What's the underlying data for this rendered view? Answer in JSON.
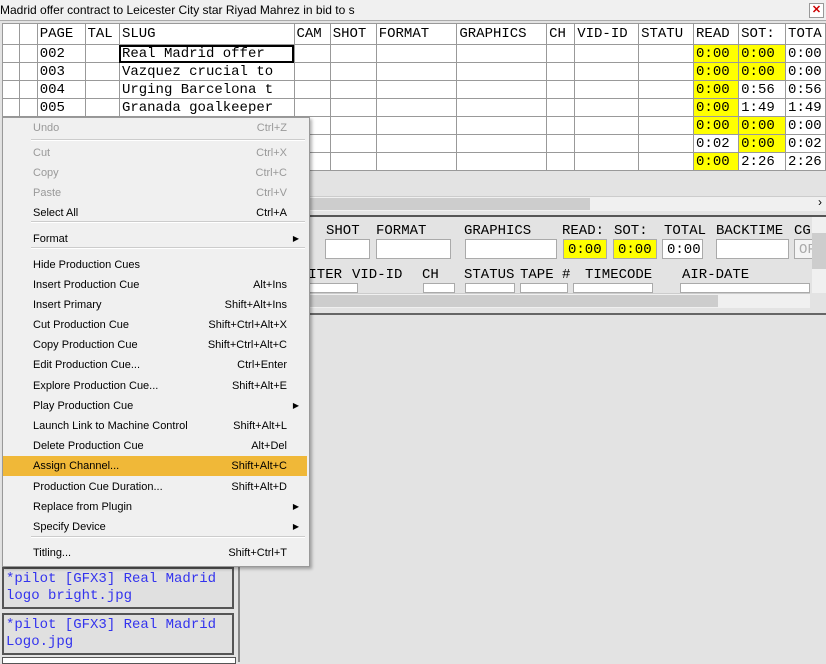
{
  "window": {
    "title": "Madrid offer contract to Leicester City star Riyad Mahrez in bid to s",
    "close_icon": "close-icon"
  },
  "grid": {
    "columns": [
      "",
      "",
      "PAGE",
      "TAL",
      "SLUG",
      "CAM",
      "SHOT",
      "FORMAT",
      "GRAPHICS",
      "CH",
      "VID-ID",
      "STATU",
      "READ",
      "SOT:",
      "TOTA"
    ],
    "rows": [
      {
        "page": "002",
        "slug": "Real Madrid offer",
        "read": "0:00",
        "sot": "0:00",
        "total": "0:00",
        "read_hl": true,
        "sot_hl": true
      },
      {
        "page": "003",
        "slug": "Vazquez crucial to",
        "read": "0:00",
        "sot": "0:00",
        "total": "0:00",
        "read_hl": true,
        "sot_hl": true
      },
      {
        "page": "004",
        "slug": "Urging Barcelona t",
        "read": "0:00",
        "sot": "0:56",
        "total": "0:56",
        "read_hl": true,
        "sot_hl": false
      },
      {
        "page": "005",
        "slug": "Granada goalkeeper",
        "read": "0:00",
        "sot": "1:49",
        "total": "1:49",
        "read_hl": true,
        "sot_hl": false
      },
      {
        "page": "",
        "slug": "",
        "read": "0:00",
        "sot": "0:00",
        "total": "0:00",
        "read_hl": true,
        "sot_hl": true
      },
      {
        "page": "",
        "slug": "",
        "read": "0:02",
        "sot": "0:00",
        "total": "0:02",
        "read_hl": false,
        "sot_hl": true
      },
      {
        "page": "",
        "slug": "",
        "read": "0:00",
        "sot": "2:26",
        "total": "2:26",
        "read_hl": true,
        "sot_hl": false
      }
    ],
    "highlight_color": "#ffff00"
  },
  "form": {
    "row1_labels": [
      "I",
      "SHOT",
      "FORMAT",
      "GRAPHICS",
      "READ:",
      "SOT:",
      "TOTAL",
      "BACKTIME",
      "CG"
    ],
    "read": "0:00",
    "sot": "0:00",
    "total": "0:00",
    "cg": "OF",
    "row2_labels": [
      "RITER",
      "VID-ID",
      "CH",
      "STATUS",
      "TAPE #",
      "TIMECODE",
      "AIR-DATE"
    ]
  },
  "menu": {
    "highlight_color": "#f0b838",
    "items": [
      {
        "label": "Undo",
        "shortcut": "Ctrl+Z",
        "disabled": true
      },
      {
        "label": "Cut",
        "shortcut": "Ctrl+X",
        "disabled": true
      },
      {
        "label": "Copy",
        "shortcut": "Ctrl+C",
        "disabled": true
      },
      {
        "label": "Paste",
        "shortcut": "Ctrl+V",
        "disabled": true
      },
      {
        "label": "Select All",
        "shortcut": "Ctrl+A"
      },
      {
        "label": "Format",
        "shortcut": "",
        "submenu": true
      },
      {
        "label": "Hide Production Cues",
        "shortcut": ""
      },
      {
        "label": "Insert Production Cue",
        "shortcut": "Alt+Ins"
      },
      {
        "label": "Insert Primary",
        "shortcut": "Shift+Alt+Ins"
      },
      {
        "label": "Cut Production Cue",
        "shortcut": "Shift+Ctrl+Alt+X"
      },
      {
        "label": "Copy Production Cue",
        "shortcut": "Shift+Ctrl+Alt+C"
      },
      {
        "label": "Edit Production Cue...",
        "shortcut": "Ctrl+Enter"
      },
      {
        "label": "Explore Production Cue...",
        "shortcut": "Shift+Alt+E"
      },
      {
        "label": "Play Production Cue",
        "shortcut": "",
        "submenu": true
      },
      {
        "label": "Launch Link to Machine Control",
        "shortcut": "Shift+Alt+L"
      },
      {
        "label": "Delete Production Cue",
        "shortcut": "Alt+Del"
      },
      {
        "label": "Assign Channel...",
        "shortcut": "Shift+Alt+C",
        "highlighted": true
      },
      {
        "label": "Production Cue Duration...",
        "shortcut": "Shift+Alt+D"
      },
      {
        "label": "Replace from Plugin",
        "shortcut": "",
        "submenu": true
      },
      {
        "label": "Specify Device",
        "shortcut": "",
        "submenu": true
      },
      {
        "label": "Titling...",
        "shortcut": "Shift+Ctrl+T"
      }
    ]
  },
  "cues": [
    {
      "text": "*pilot [GFX3] Real Madrid logo bright.jpg"
    },
    {
      "text": "*pilot [GFX3] Real Madrid Logo.jpg"
    }
  ]
}
